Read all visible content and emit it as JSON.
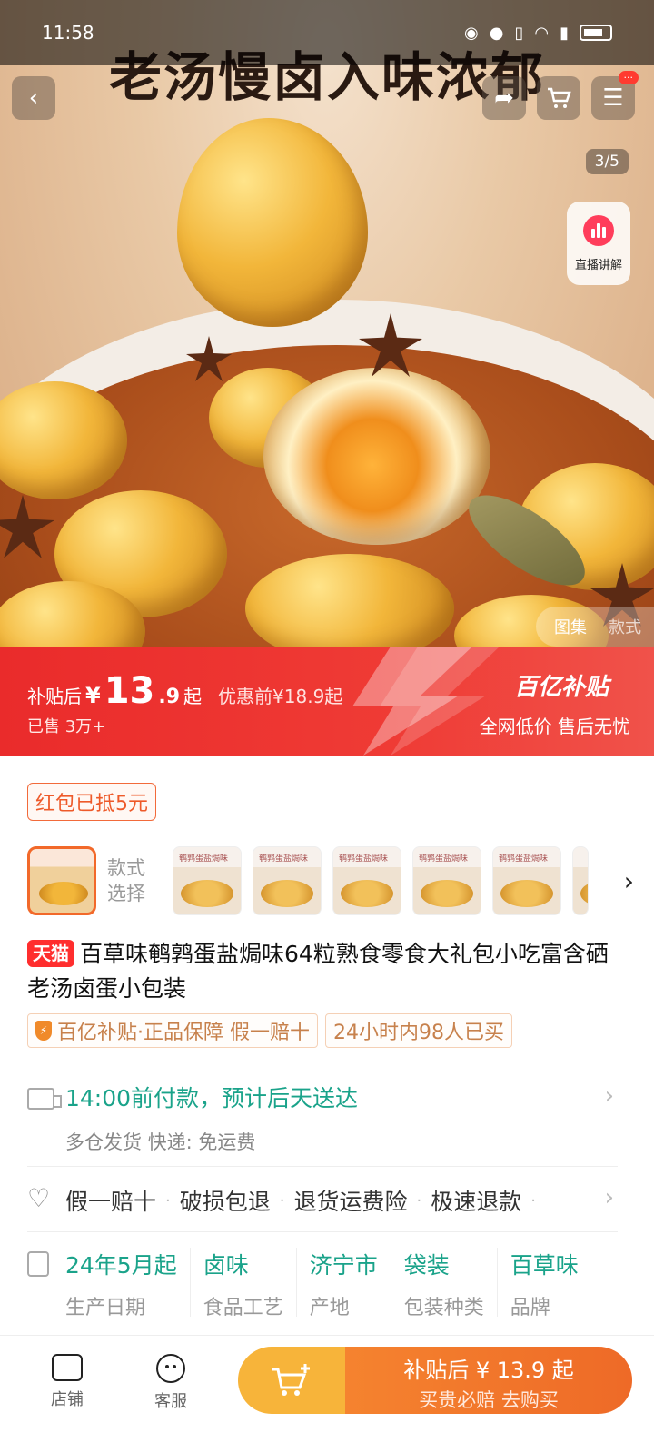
{
  "status": {
    "time": "11:58"
  },
  "hero": {
    "headline": "老汤慢卤入味浓郁",
    "counter": "3/5",
    "live_label": "直播讲解",
    "gallery_tabs": [
      "图集",
      "款式"
    ],
    "badge": "···"
  },
  "promo": {
    "label": "补贴后",
    "currency": "¥",
    "price_int": "13",
    "price_dec": ".9",
    "qi": "起",
    "original": "优惠前¥18.9起",
    "sold": "已售 3万+",
    "brand": "百亿补贴",
    "slogan": "全网低价 售后无忧"
  },
  "coupon": "红包已抵5元",
  "variants": {
    "label": "款式选择",
    "thumb_text": "鹌鹑蛋盐焗味"
  },
  "product": {
    "store_badge": "天猫",
    "title": "百草味鹌鹑蛋盐焗味64粒熟食零食大礼包小吃富含硒老汤卤蛋小包装",
    "tags": [
      "百亿补贴·正品保障 假一赔十",
      "24小时内98人已买"
    ]
  },
  "shipping": {
    "main": "14:00前付款，预计后天送达",
    "sub": "多仓发货  快递: 免运费"
  },
  "guarantees": [
    "假一赔十",
    "破损包退",
    "退货运费险",
    "极速退款"
  ],
  "specs": [
    {
      "value": "24年5月起",
      "key": "生产日期"
    },
    {
      "value": "卤味",
      "key": "食品工艺"
    },
    {
      "value": "济宁市",
      "key": "产地"
    },
    {
      "value": "袋装",
      "key": "包装种类"
    },
    {
      "value": "百草味",
      "key": "品牌"
    }
  ],
  "bottom": {
    "shop": "店铺",
    "service": "客服",
    "buy_line1": "补贴后 ¥ 13.9 起",
    "buy_line2": "买贵必赔 去购买"
  }
}
